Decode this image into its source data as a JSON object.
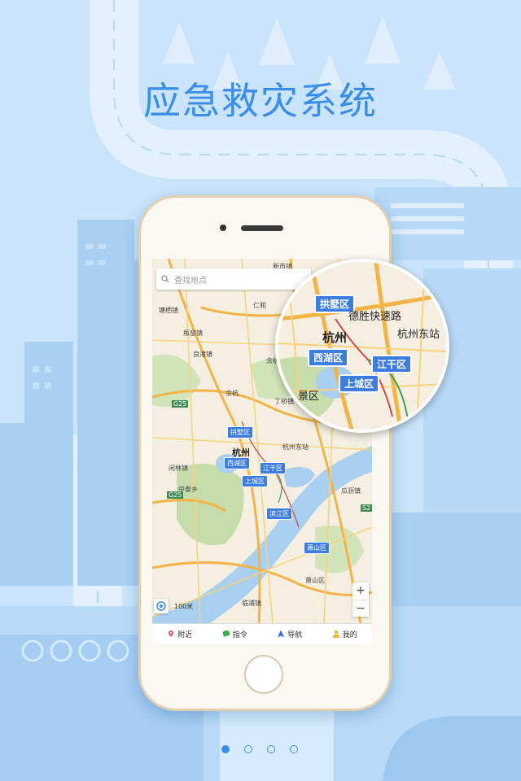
{
  "title": "应急救灾系统",
  "search": {
    "placeholder": "查找地点"
  },
  "map": {
    "city": "杭州",
    "districts": [
      "拱墅区",
      "西湖区",
      "江干区",
      "上城区",
      "滨江区",
      "萧山区"
    ],
    "labels": [
      "新市镇",
      "塘栖镇",
      "瓶窑镇",
      "良渚镇",
      "余杭",
      "仁和",
      "丁桥镇",
      "杭州东站",
      "闲林镇",
      "中泰乡",
      "余杭区",
      "萧山区",
      "临浦镇",
      "瓜沥镇"
    ],
    "road_shields": [
      "G25",
      "G25",
      "S2"
    ],
    "scale": "100米"
  },
  "magnifier": {
    "city": "杭州",
    "districts": [
      "拱墅区",
      "西湖区",
      "江干区",
      "上城区"
    ],
    "labels": [
      "德胜快速路",
      "杭州东站",
      "景区"
    ]
  },
  "zoom": {
    "in": "+",
    "out": "−"
  },
  "tabs": [
    {
      "label": "附近",
      "icon": "location-pin-icon"
    },
    {
      "label": "指令",
      "icon": "chat-bubble-icon"
    },
    {
      "label": "导航",
      "icon": "navigation-arrow-icon"
    },
    {
      "label": "我的",
      "icon": "person-icon"
    }
  ],
  "pager": {
    "count": 4,
    "active": 0
  },
  "colors": {
    "accent": "#3a8ee8",
    "badge": "#3c7de0",
    "background": "#c9e4fb"
  }
}
